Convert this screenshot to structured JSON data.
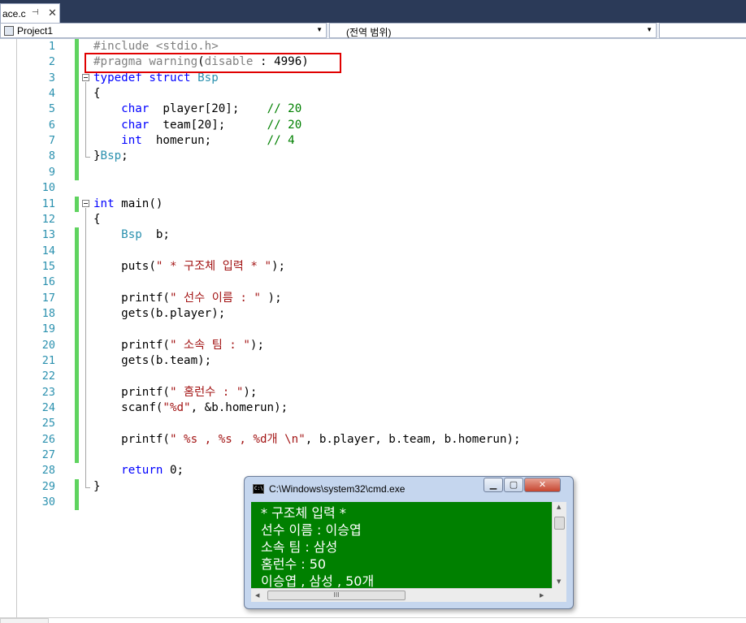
{
  "tab": {
    "name": "ace.c",
    "pin": "⊣",
    "close": "✕"
  },
  "nav": {
    "project": "Project1",
    "scope": "(전역 범위)"
  },
  "code_lines": [
    "1",
    "2",
    "3",
    "4",
    "5",
    "6",
    "7",
    "8",
    "9",
    "10",
    "11",
    "12",
    "13",
    "14",
    "15",
    "16",
    "17",
    "18",
    "19",
    "20",
    "21",
    "22",
    "23",
    "24",
    "25",
    "26",
    "27",
    "28",
    "29",
    "30"
  ],
  "code": {
    "l1": [
      "#include <stdio.h>"
    ],
    "l2": [
      "#pragma warning",
      "(",
      "disable",
      " : 4996)"
    ],
    "l3": [
      "typedef",
      " struct ",
      "Bsp"
    ],
    "l4": [
      "{"
    ],
    "l5": [
      "    ",
      "char",
      "  player[20];    ",
      "// 20"
    ],
    "l6": [
      "    ",
      "char",
      "  team[20];      ",
      "// 20"
    ],
    "l7": [
      "    ",
      "int",
      "  homerun;        ",
      "// 4"
    ],
    "l8": [
      "}",
      "Bsp",
      ";"
    ],
    "l11": [
      "int",
      " main()"
    ],
    "l12": [
      "{"
    ],
    "l13": [
      "    ",
      "Bsp",
      "  b;"
    ],
    "l15": [
      "    puts(",
      "\" * 구조체 입력 * \"",
      ");"
    ],
    "l17": [
      "    printf(",
      "\" 선수 이름 : \"",
      " );"
    ],
    "l18": [
      "    gets(b.player);"
    ],
    "l20": [
      "    printf(",
      "\" 소속 팀 : \"",
      ");"
    ],
    "l21": [
      "    gets(b.team);"
    ],
    "l23": [
      "    printf(",
      "\" 홈런수 : \"",
      ");"
    ],
    "l24": [
      "    scanf(",
      "\"%d\"",
      ", &b.homerun);"
    ],
    "l26": [
      "    printf(",
      "\" %s , %s , %d개 \\n\"",
      ", b.player, b.team, b.homerun);"
    ],
    "l28": [
      "    ",
      "return",
      " 0;"
    ],
    "l29": [
      "}"
    ]
  },
  "console": {
    "title": "C:\\Windows\\system32\\cmd.exe",
    "lines": [
      "* 구조체 입력 *",
      "선수 이름 : 이승엽",
      "소속 팀 : 삼성",
      "홈런수 : 50",
      "이승엽 , 삼성 , 50개"
    ]
  }
}
